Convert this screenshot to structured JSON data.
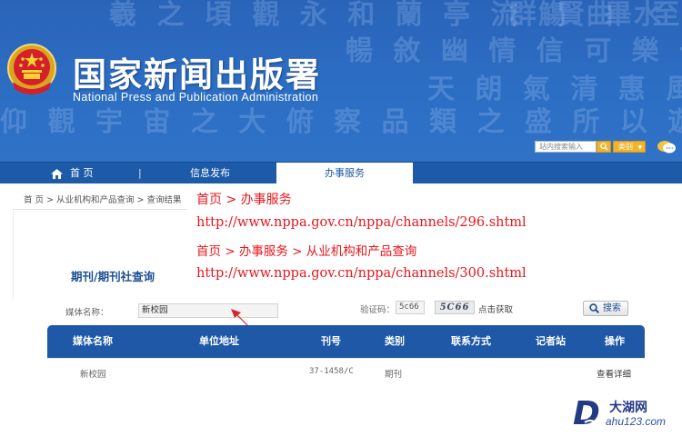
{
  "header": {
    "title": "国家新闻出版署",
    "subtitle": "National  Press and Publication Administration",
    "search_placeholder": "站内搜索输入",
    "category_label": "类别"
  },
  "nav": {
    "items": [
      "首 页",
      "|",
      "信息发布",
      "办事服务"
    ],
    "active": "办事服务"
  },
  "breadcrumb": "首 页 > 从业机构和产品查询 > 查询结果",
  "annotations": [
    "首页 > 办事服务",
    "http://www.nppa.gov.cn/nppa/channels/296.shtml",
    "首页 > 办事服务 > 从业机构和产品查询",
    "http://www.nppa.gov.cn/nppa/channels/300.shtml"
  ],
  "section_title": "期刊/期刊社查询",
  "form": {
    "media_label": "媒体名称：",
    "media_value": "新校园",
    "captcha_label": "验证码：",
    "captcha_input_value": "5c66",
    "captcha_image_text": "5C66",
    "captcha_refresh": "点击获取",
    "search_button": "搜索"
  },
  "table": {
    "columns": [
      "媒体名称",
      "单位地址",
      "刊号",
      "类别",
      "联系方式",
      "记者站",
      "操作"
    ],
    "rows": [
      {
        "media_name": "新校园",
        "address": "",
        "issn": "37-1458/C",
        "category": "期刊",
        "contact": "",
        "station": "",
        "action": "查看详细"
      }
    ]
  },
  "watermark": {
    "letter": "D",
    "name": "大湖网",
    "url": "ahu123.com"
  },
  "colors": {
    "banner_blue": "#2c6ec4",
    "nav_blue": "#1d5aa8",
    "annotation_red": "#e8161c",
    "table_header_blue": "#1f58a6",
    "accent_orange": "#f0b42a"
  }
}
